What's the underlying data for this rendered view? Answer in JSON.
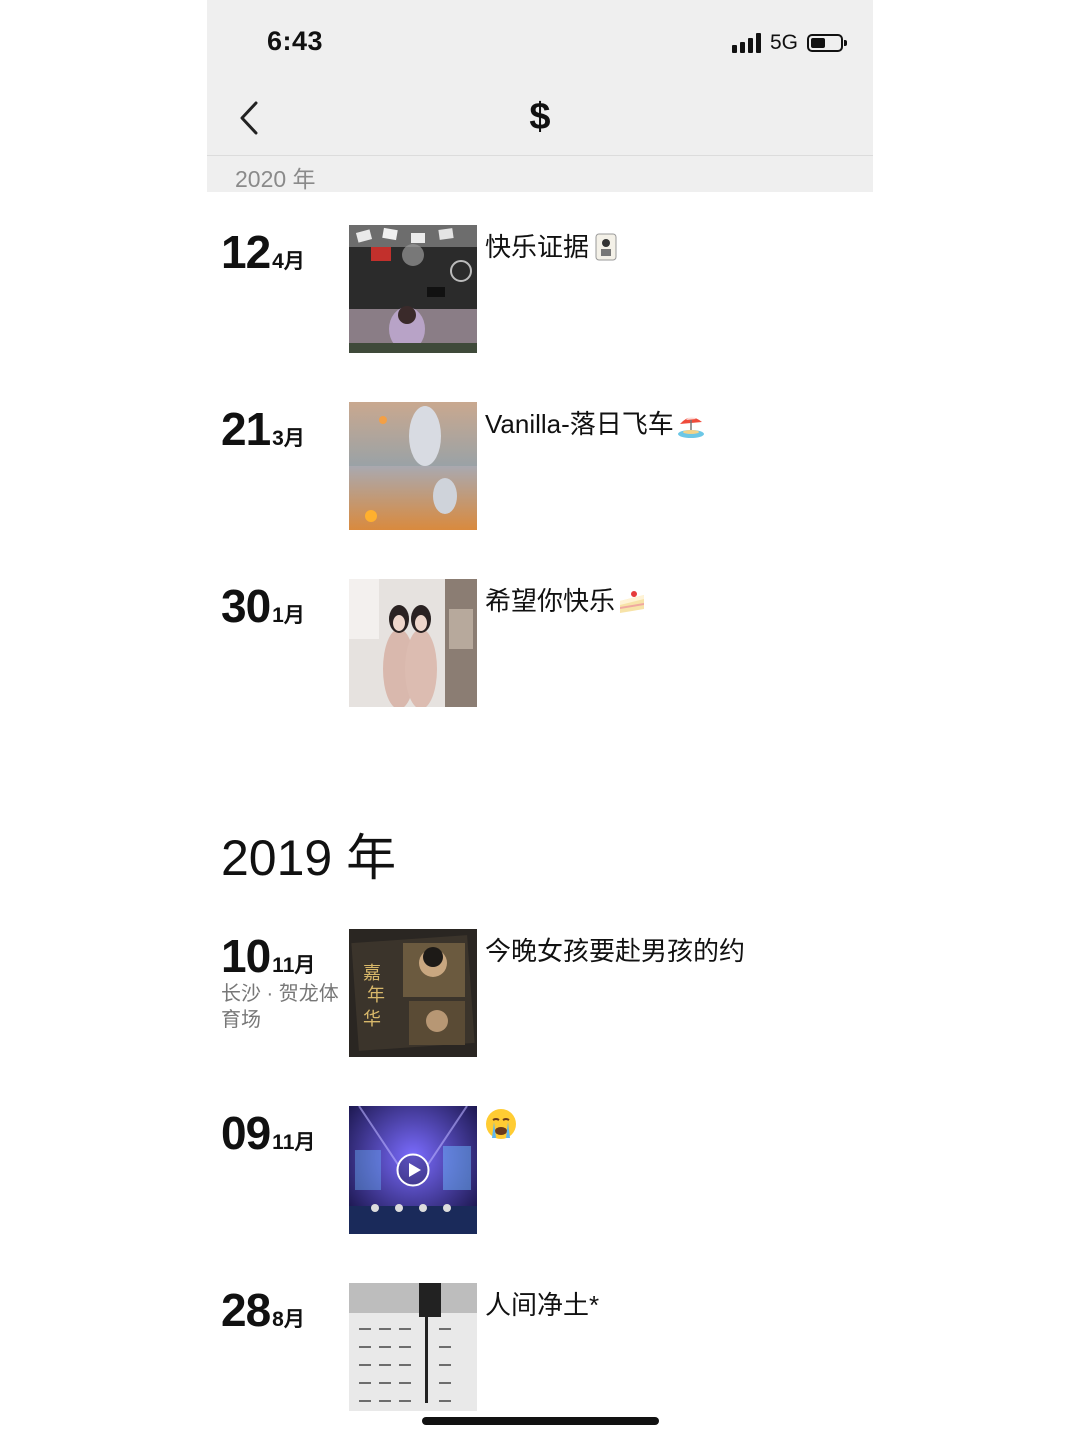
{
  "status_bar": {
    "time": "6:43",
    "network": "5G"
  },
  "header": {
    "title": "$"
  },
  "sticky_year": "2020 年",
  "year_2019_heading": "2019 年",
  "entries": [
    {
      "day": "12",
      "month": "4月",
      "place": "",
      "caption": "快乐证据",
      "emoji": "mahjong-icon"
    },
    {
      "day": "21",
      "month": "3月",
      "place": "",
      "caption": "Vanilla-落日飞车",
      "emoji": "beach-icon"
    },
    {
      "day": "30",
      "month": "1月",
      "place": "",
      "caption": "希望你快乐",
      "emoji": "cake-icon"
    },
    {
      "day": "10",
      "month": "11月",
      "place": "长沙 · 贺龙体育场",
      "caption": "今晚女孩要赴男孩的约",
      "emoji": ""
    },
    {
      "day": "09",
      "month": "11月",
      "place": "",
      "caption": "",
      "emoji": "crying-face-icon"
    },
    {
      "day": "28",
      "month": "8月",
      "place": "",
      "caption": "人间净土*",
      "emoji": ""
    }
  ]
}
